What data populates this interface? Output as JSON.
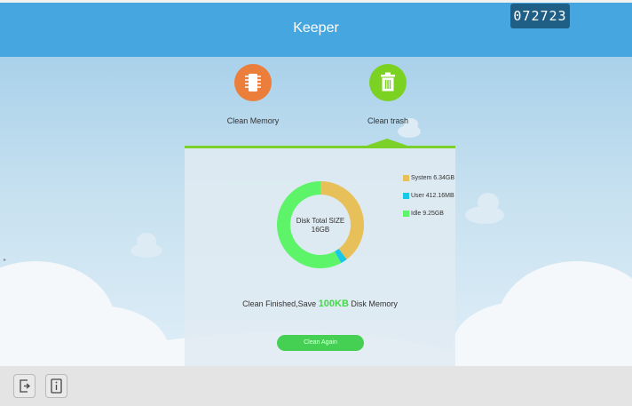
{
  "header": {
    "title": "Keeper",
    "badge": "072723"
  },
  "tools": [
    {
      "label": "Clean Memory",
      "icon": "memory-chip-icon",
      "color": "#ec7e3c"
    },
    {
      "label": "Clean trash",
      "icon": "trash-can-icon",
      "color": "#7cd223"
    }
  ],
  "disk": {
    "center_label_line1": "Disk Total SIZE",
    "center_label_line2": "16GB",
    "legend": [
      {
        "label": "System 6.34GB",
        "color": "#e8c05a",
        "value_gb": 6.34
      },
      {
        "label": "User 412.16MB",
        "color": "#19c7e6",
        "value_gb": 0.4025
      },
      {
        "label": "Idle 9.25GB",
        "color": "#5ef46a",
        "value_gb": 9.25
      }
    ]
  },
  "result": {
    "prefix": "Clean Finished,Save ",
    "amount": "100KB",
    "suffix": " Disk Memory"
  },
  "button": {
    "label": "Clean Again"
  },
  "footer": {
    "buttons": [
      {
        "icon": "exit-icon"
      },
      {
        "icon": "info-icon"
      }
    ]
  }
}
